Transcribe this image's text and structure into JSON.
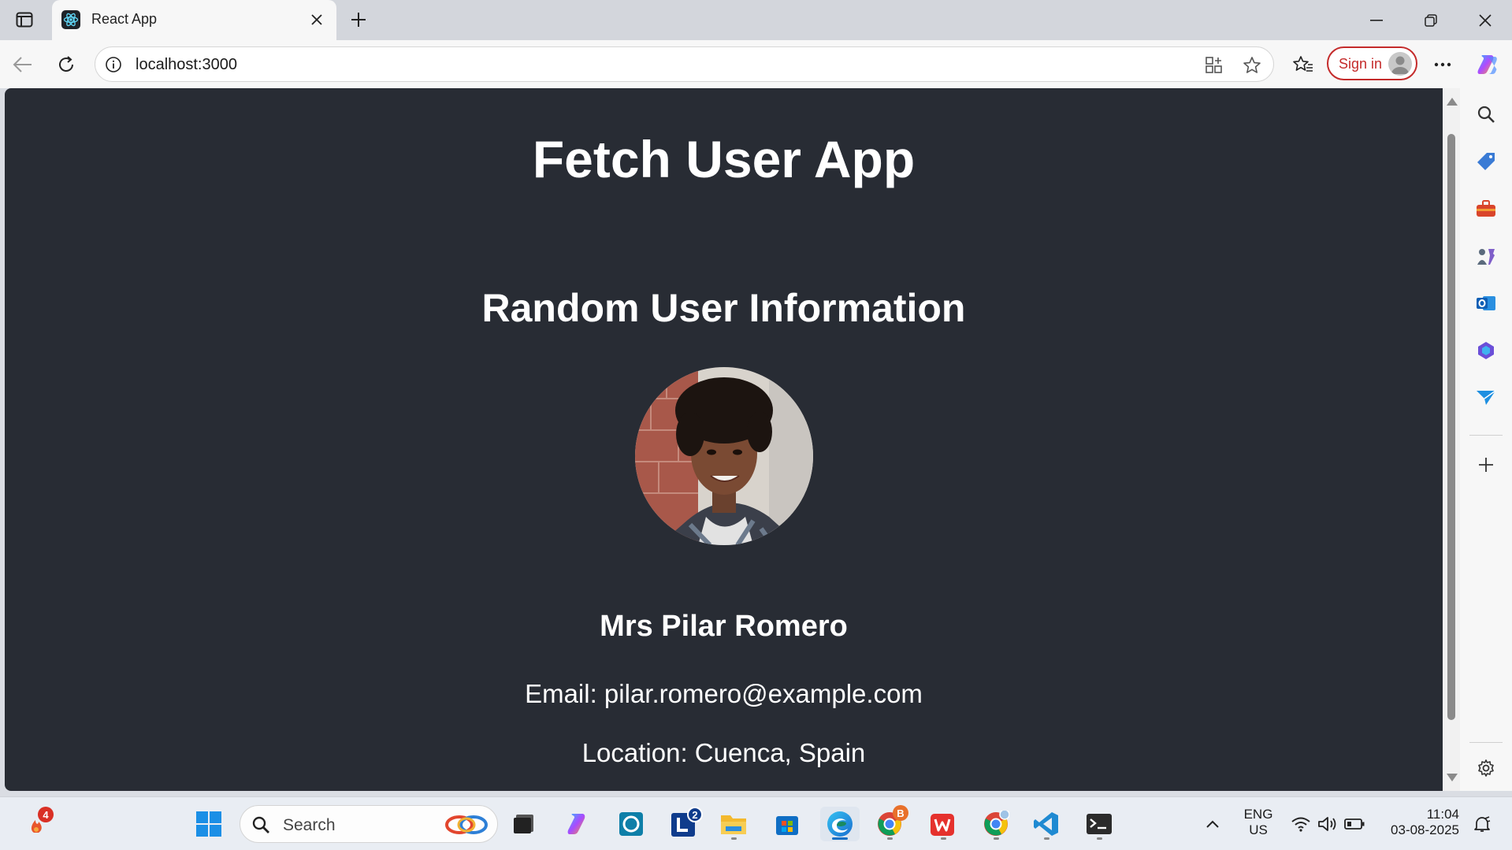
{
  "browser": {
    "tab": {
      "title": "React App",
      "favicon": "react-icon"
    },
    "address": {
      "url": "localhost:3000"
    },
    "signin_label": "Sign in"
  },
  "page": {
    "app_title": "Fetch User App",
    "section_title": "Random User Information",
    "user": {
      "name": "Mrs Pilar Romero",
      "email_line": "Email: pilar.romero@example.com",
      "location_line": "Location: Cuenca, Spain"
    }
  },
  "taskbar": {
    "search_placeholder": "Search",
    "weather_badge": "4",
    "teams_badge": "2",
    "chrome_badge": "B",
    "language": {
      "line1": "ENG",
      "line2": "US"
    },
    "clock": {
      "time": "11:04",
      "date": "03-08-2025"
    }
  },
  "colors": {
    "page_background": "#282c34",
    "page_text": "#ffffff",
    "signin_accent": "#c42b2b",
    "badge_red": "#d93025"
  }
}
